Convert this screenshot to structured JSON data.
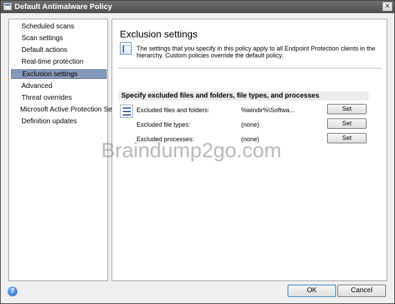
{
  "window": {
    "title": "Default Antimalware Policy",
    "close_glyph": "✕"
  },
  "nav": {
    "items": [
      {
        "label": "Scheduled scans"
      },
      {
        "label": "Scan settings"
      },
      {
        "label": "Default actions"
      },
      {
        "label": "Real-time protection"
      },
      {
        "label": "Exclusion settings",
        "selected": true
      },
      {
        "label": "Advanced"
      },
      {
        "label": "Threat overrides"
      },
      {
        "label": "Microsoft Active Protection Service"
      },
      {
        "label": "Definition updates"
      }
    ]
  },
  "main": {
    "title": "Exclusion settings",
    "info_text": "The settings that you specify in this policy apply to all Endpoint Protection clients in the hierarchy. Custom policies override the default policy.",
    "section_header": "Specify excluded files and folders, file types, and processes",
    "rows": [
      {
        "label": "Excluded files and folders:",
        "value": "%windir%\\Softwa...",
        "button": "Set"
      },
      {
        "label": "Excluded file types:",
        "value": "(none)",
        "button": "Set"
      },
      {
        "label": "Excluded processes:",
        "value": "(none)",
        "button": "Set"
      }
    ]
  },
  "watermark": "Braindump2go.com",
  "footer": {
    "help_glyph": "?",
    "ok_label": "OK",
    "cancel_label": "Cancel"
  },
  "colors": {
    "selected_nav": "#8799b8",
    "title_bar": "#5a5a5a"
  }
}
